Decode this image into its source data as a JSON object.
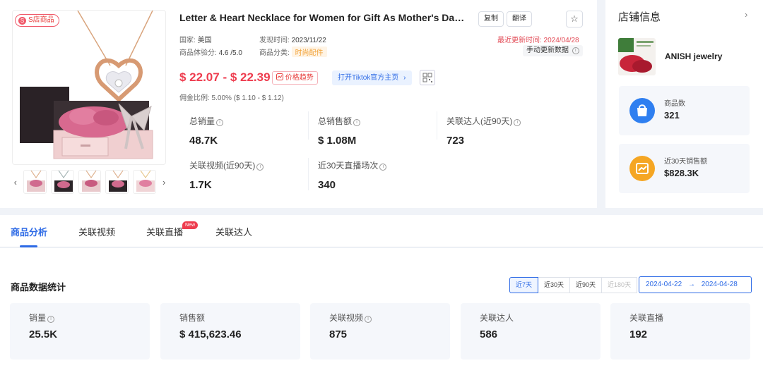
{
  "product": {
    "badge": "S店商品",
    "title": "Letter & Heart Necklace for Women for Gift As Mother's Day Gift,...",
    "copy_label": "复制",
    "translate_label": "翻译",
    "star_icon": "☆",
    "country_label": "国家:",
    "country": "美国",
    "found_label": "发现时间:",
    "found_date": "2023/11/22",
    "rating_label": "商品体验分:",
    "rating": "4.6 /5.0",
    "category_label": "商品分类:",
    "category": "时尚配件",
    "updated": "最近更新时间: 2024/04/28",
    "manual_update": "手动更新数据",
    "price": "$ 22.07 - $ 22.39",
    "trend_label": "价格趋势",
    "tiktok_label": "打开Tiktok官方主页",
    "commission": "佣金比例: 5.00% ($ 1.10 - $ 1.12)",
    "thumb_prev": "‹",
    "thumb_next": "›",
    "stats": {
      "sales_label": "总销量",
      "sales": "48.7K",
      "revenue_label": "总销售额",
      "revenue": "$ 1.08M",
      "influencers_label": "关联达人(近90天)",
      "influencers": "723",
      "videos_label": "关联视频(近90天)",
      "videos": "1.7K",
      "lives_label": "近30天直播场次",
      "lives": "340"
    }
  },
  "shop": {
    "title": "店铺信息",
    "chevron": "›",
    "name": "ANISH jewelry",
    "products_label": "商品数",
    "products": "321",
    "sales30_label": "近30天销售额",
    "sales30": "$828.3K"
  },
  "tabs": {
    "analysis": "商品分析",
    "videos": "关联视频",
    "live": "关联直播",
    "live_badge": "New",
    "influencers": "关联达人"
  },
  "stats": {
    "title": "商品数据统计",
    "range_7": "近7天",
    "range_30": "近30天",
    "range_90": "近90天",
    "range_180": "近180天",
    "date_start": "2024-04-22",
    "date_arrow": "→",
    "date_end": "2024-04-28",
    "cards": {
      "sales_label": "销量",
      "sales": "25.5K",
      "revenue_label": "销售额",
      "revenue": "$ 415,623.46",
      "videos_label": "关联视频",
      "videos": "875",
      "influencers_label": "关联达人",
      "influencers": "586",
      "lives_label": "关联直播",
      "lives": "192"
    }
  },
  "colors": {
    "accent": "#2e6be6",
    "price": "#ee3d4f",
    "category_tag": "#f2a33a"
  }
}
